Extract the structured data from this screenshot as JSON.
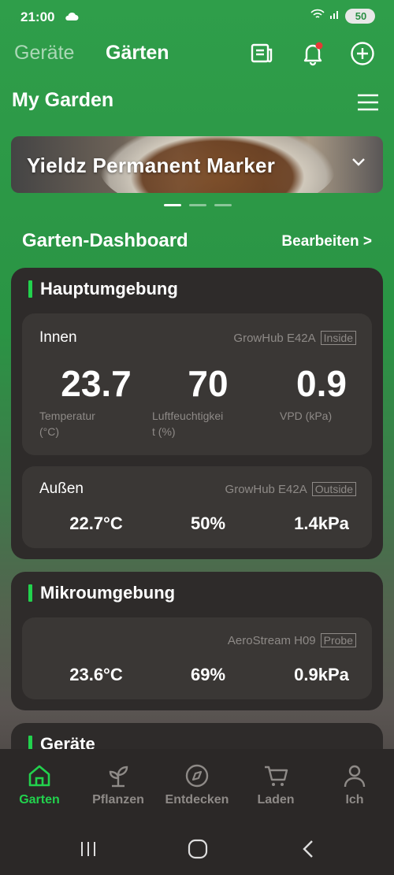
{
  "status": {
    "time": "21:00",
    "battery": "50"
  },
  "topnav": {
    "devices_tab": "Geräte",
    "gardens_tab": "Gärten"
  },
  "page": {
    "title": "My Garden"
  },
  "banner": {
    "title": "Yieldz Permanent Marker"
  },
  "dashboard": {
    "title": "Garten-Dashboard",
    "edit": "Bearbeiten >"
  },
  "main_env": {
    "title": "Hauptumgebung",
    "inside": {
      "label": "Innen",
      "device": "GrowHub E42A",
      "tag": "Inside",
      "temp": "23.7",
      "humidity": "70",
      "vpd": "0.9",
      "temp_label_1": "Temperatur",
      "temp_label_2": "(°C)",
      "hum_label_1": "Luftfeuchtigkei",
      "hum_label_2": "t (%)",
      "vpd_label": "VPD (kPa)"
    },
    "outside": {
      "label": "Außen",
      "device": "GrowHub E42A",
      "tag": "Outside",
      "temp": "22.7°C",
      "humidity": "50%",
      "vpd": "1.4kPa"
    }
  },
  "micro_env": {
    "title": "Mikroumgebung",
    "probe": {
      "device": "AeroStream H09",
      "tag": "Probe",
      "temp": "23.6°C",
      "humidity": "69%",
      "vpd": "0.9kPa"
    }
  },
  "devices_section": {
    "title": "Geräte"
  },
  "bottom_nav": [
    {
      "label": "Garten",
      "icon": "home-icon"
    },
    {
      "label": "Pflanzen",
      "icon": "sprout-icon"
    },
    {
      "label": "Entdecken",
      "icon": "compass-icon"
    },
    {
      "label": "Laden",
      "icon": "cart-icon"
    },
    {
      "label": "Ich",
      "icon": "person-icon"
    }
  ],
  "colors": {
    "accent": "#22d24d",
    "card": "#2e2b2a",
    "subcard": "#3a3735",
    "muted": "#8e8a87"
  }
}
